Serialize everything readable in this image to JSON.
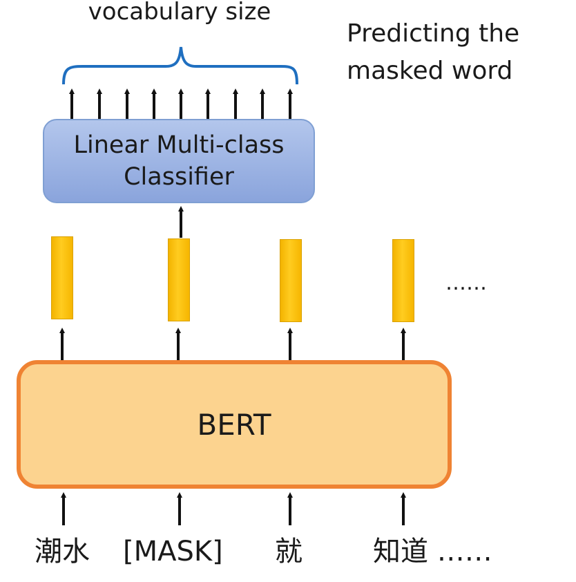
{
  "top_label": "vocabulary size",
  "side_label": "Predicting the masked word",
  "classifier": {
    "line1": "Linear Multi-class",
    "line2": "Classifier"
  },
  "encoder_label": "BERT",
  "vector_ellipsis": "……",
  "tokens": [
    "潮水",
    "[MASK]",
    "就",
    "知道 ……"
  ],
  "colors": {
    "classifier_fill": "#9bb2e4",
    "encoder_fill": "#fcd38f",
    "encoder_border": "#ef8333",
    "vector_fill": "#ffc000",
    "brace": "#1f6fc0"
  }
}
